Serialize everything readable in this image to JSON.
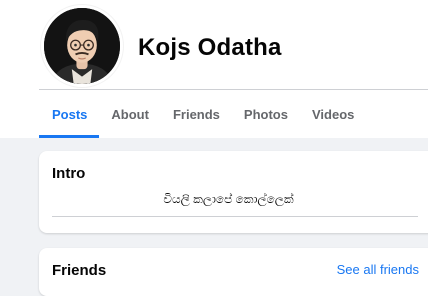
{
  "profile": {
    "name": "Kojs Odatha"
  },
  "tabs": [
    {
      "label": "Posts",
      "active": true
    },
    {
      "label": "About",
      "active": false
    },
    {
      "label": "Friends",
      "active": false
    },
    {
      "label": "Photos",
      "active": false
    },
    {
      "label": "Videos",
      "active": false
    }
  ],
  "intro": {
    "title": "Intro",
    "bio": "වියලි කලාපේ කොල්ලෙක්"
  },
  "friends": {
    "title": "Friends",
    "see_all": "See all friends"
  },
  "colors": {
    "accent": "#1877f2",
    "page_bg": "#f0f2f5",
    "card_bg": "#ffffff",
    "secondary_text": "#65676b"
  }
}
